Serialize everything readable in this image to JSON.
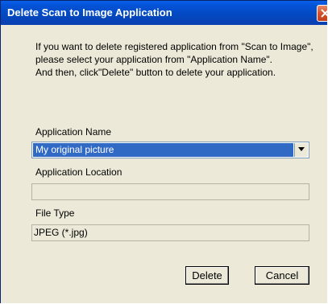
{
  "dialog": {
    "title": "Delete Scan to Image Application",
    "message": "If you want to delete registered application from \"Scan to Image\", please select your application from \"Application Name\".\nAnd then, click\"Delete\" button to delete your application.",
    "application_name": {
      "label": "Application Name",
      "selected_value": "My original picture"
    },
    "application_location": {
      "label": "Application Location",
      "value": ""
    },
    "file_type": {
      "label": "File Type",
      "value": "JPEG (*.jpg)"
    },
    "buttons": {
      "delete_label": "Delete",
      "cancel_label": "Cancel"
    },
    "icons": {
      "close": "close-icon",
      "dropdown": "chevron-down-icon"
    },
    "colors": {
      "titlebar": "#0348c0",
      "selection": "#316ac5",
      "close_button": "#d2532c",
      "dialog_face": "#ece9d8"
    }
  }
}
